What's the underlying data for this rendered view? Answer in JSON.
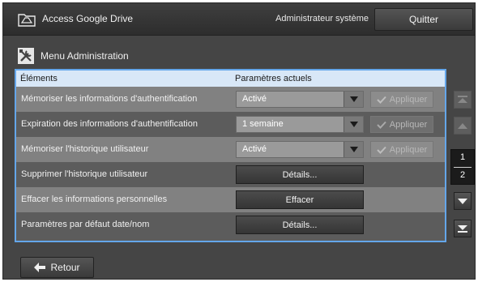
{
  "header": {
    "app_title": "Access Google Drive",
    "user_label": "Administrateur système",
    "quit_label": "Quitter"
  },
  "section": {
    "title": "Menu Administration"
  },
  "table": {
    "col_items": "Éléments",
    "col_settings": "Paramètres actuels",
    "rows": [
      {
        "label": "Mémoriser les informations d'authentification",
        "value": "Activé",
        "apply": "Appliquer"
      },
      {
        "label": "Expiration des informations d'authentification",
        "value": "1 semaine",
        "apply": "Appliquer"
      },
      {
        "label": "Mémoriser l'historique utilisateur",
        "value": "Activé",
        "apply": "Appliquer"
      },
      {
        "label": "Supprimer l'historique utilisateur",
        "action": "Détails..."
      },
      {
        "label": "Effacer les informations personnelles",
        "action": "Effacer"
      },
      {
        "label": "Paramètres par défaut date/nom",
        "action": "Détails..."
      }
    ]
  },
  "pager": {
    "current": "1",
    "total": "2"
  },
  "footer": {
    "back_label": "Retour"
  },
  "icons": {
    "app": "folder-drive-icon",
    "tools": "tools-icon",
    "check": "check-icon",
    "dropdown": "dropdown-arrow-icon",
    "back": "arrow-left-icon",
    "scroll_top": "scroll-top-icon",
    "scroll_up": "scroll-up-icon",
    "scroll_down": "scroll-down-icon",
    "scroll_bottom": "scroll-bottom-icon"
  },
  "colors": {
    "table_border": "#64a6ea",
    "header_row": "#d8e7f7"
  }
}
